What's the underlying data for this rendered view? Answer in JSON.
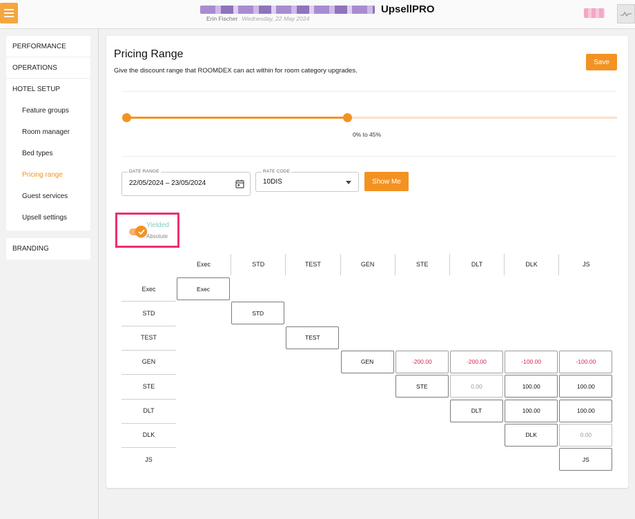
{
  "header": {
    "app_title": "UpsellPRO",
    "user_name": "Erin Fischer",
    "date": "Wednesday, 22 May 2024"
  },
  "sidebar": {
    "performance": "PERFORMANCE",
    "operations": "OPERATIONS",
    "hotel_setup": "HOTEL SETUP",
    "items": [
      {
        "label": "Feature groups"
      },
      {
        "label": "Room manager"
      },
      {
        "label": "Bed types"
      },
      {
        "label": "Pricing range",
        "active": true
      },
      {
        "label": "Guest services"
      },
      {
        "label": "Upsell settings"
      }
    ],
    "branding": "BRANDING"
  },
  "main": {
    "title": "Pricing Range",
    "subtitle": "Give the discount range that ROOMDEX can act within for room category upgrades.",
    "save_label": "Save",
    "slider": {
      "min_percent": 0,
      "max_percent": 45,
      "label": "0% to 45%"
    },
    "date_range": {
      "legend": "DATE RANGE",
      "value": "22/05/2024 – 23/05/2024"
    },
    "rate_code": {
      "legend": "RATE CODE",
      "value": "10DIS"
    },
    "show_label": "Show Me",
    "toggle": {
      "on_label": "Yielded",
      "off_label": "Absolute",
      "checked": true
    },
    "categories": [
      "Exec",
      "STD",
      "TEST",
      "GEN",
      "STE",
      "DLT",
      "DLK",
      "JS"
    ],
    "matrix": [
      [
        "Exec",
        "",
        "",
        "",
        "",
        "",
        "",
        ""
      ],
      [
        "",
        "STD",
        "",
        "",
        "",
        "",
        "",
        ""
      ],
      [
        "",
        "",
        "TEST",
        "",
        "",
        "",
        "",
        ""
      ],
      [
        "",
        "",
        "",
        "GEN",
        "-200.00",
        "-200.00",
        "-100.00",
        "-100.00"
      ],
      [
        "",
        "",
        "",
        "",
        "STE",
        "0.00",
        "100.00",
        "100.00"
      ],
      [
        "",
        "",
        "",
        "",
        "",
        "DLT",
        "100.00",
        "100.00"
      ],
      [
        "",
        "",
        "",
        "",
        "",
        "",
        "DLK",
        "0.00"
      ],
      [
        "",
        "",
        "",
        "",
        "",
        "",
        "",
        "JS"
      ]
    ]
  },
  "colors": {
    "accent": "#f39221",
    "negative": "#d6264f",
    "highlight": "#ec2f6e",
    "toggle_on_text": "#8ac7c0"
  }
}
